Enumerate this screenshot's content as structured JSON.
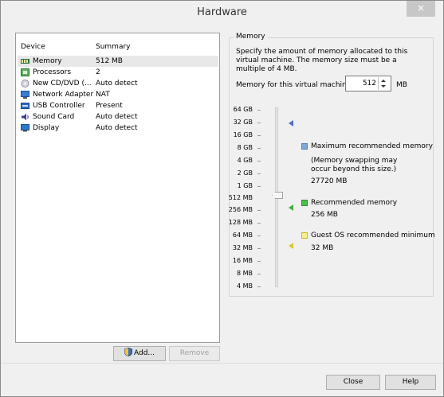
{
  "window": {
    "title": "Hardware",
    "close_glyph": "×"
  },
  "devices": {
    "headers": {
      "device": "Device",
      "summary": "Summary"
    },
    "rows": [
      {
        "name": "Memory",
        "summary": "512 MB",
        "icon": "memory-icon",
        "selected": true
      },
      {
        "name": "Processors",
        "summary": "2",
        "icon": "processor-icon"
      },
      {
        "name": "New CD/DVD (...",
        "summary": "Auto detect",
        "icon": "cd-dvd-icon"
      },
      {
        "name": "Network Adapter",
        "summary": "NAT",
        "icon": "network-adapter-icon"
      },
      {
        "name": "USB Controller",
        "summary": "Present",
        "icon": "usb-controller-icon"
      },
      {
        "name": "Sound Card",
        "summary": "Auto detect",
        "icon": "sound-card-icon"
      },
      {
        "name": "Display",
        "summary": "Auto detect",
        "icon": "display-icon"
      }
    ],
    "add_label": "Add...",
    "remove_label": "Remove"
  },
  "memory": {
    "group_label": "Memory",
    "description": "Specify the amount of memory allocated to this virtual machine. The memory size must be a multiple of 4 MB.",
    "field_label": "Memory for this virtual machine:",
    "value": "512",
    "unit": "MB",
    "scale_labels": [
      "64 GB",
      "32 GB",
      "16 GB",
      "8 GB",
      "4 GB",
      "2 GB",
      "1 GB",
      "512 MB",
      "256 MB",
      "128 MB",
      "64 MB",
      "32 MB",
      "16 MB",
      "8 MB",
      "4 MB"
    ],
    "max_recommended": {
      "title": "Maximum recommended memory",
      "note": "(Memory swapping may occur beyond this size.)",
      "value": "27720 MB",
      "color": "#4f81bd"
    },
    "recommended": {
      "title": "Recommended memory",
      "value": "256 MB",
      "color": "#3fae3f"
    },
    "guest_min": {
      "title": "Guest OS recommended minimum",
      "value": "32 MB",
      "color": "#e8e05a"
    }
  },
  "footer": {
    "close_label": "Close",
    "help_label": "Help"
  }
}
